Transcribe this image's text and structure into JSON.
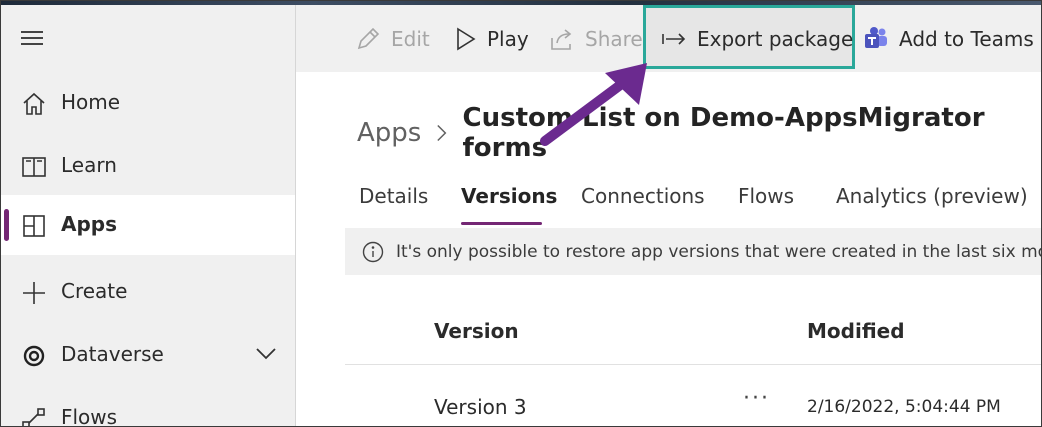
{
  "sidebar": {
    "items": [
      {
        "label": "Home",
        "icon": "home-icon"
      },
      {
        "label": "Learn",
        "icon": "book-icon"
      },
      {
        "label": "Apps",
        "icon": "apps-icon",
        "active": true
      },
      {
        "label": "Create",
        "icon": "plus-icon"
      },
      {
        "label": "Dataverse",
        "icon": "dataverse-icon"
      },
      {
        "label": "Flows",
        "icon": "flows-icon"
      }
    ]
  },
  "toolbar": {
    "edit_label": "Edit",
    "play_label": "Play",
    "share_label": "Share",
    "export_label": "Export package",
    "teams_label": "Add to Teams"
  },
  "breadcrumb": {
    "root": "Apps",
    "title": "Custom List on Demo-AppsMigrator forms"
  },
  "tabs": [
    "Details",
    "Versions",
    "Connections",
    "Flows",
    "Analytics (preview)"
  ],
  "info": {
    "message": "It's only possible to restore app versions that were created in the last six months."
  },
  "table": {
    "headers": [
      "Version",
      "Modified"
    ],
    "rows": [
      {
        "version": "Version 3",
        "more": "···",
        "modified": "2/16/2022, 5:04:44 PM"
      }
    ]
  },
  "colors": {
    "accent": "#742774",
    "highlight_box": "#2aa89a",
    "arrow": "#6b2a8f"
  }
}
